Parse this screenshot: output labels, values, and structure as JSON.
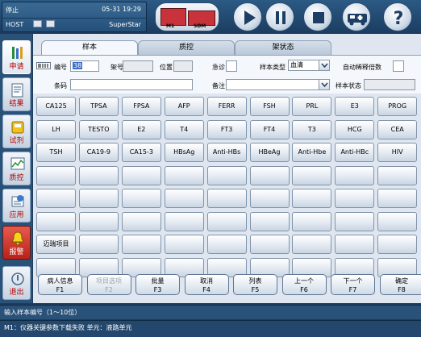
{
  "status": {
    "state": "停止",
    "time": "05-31 19:29",
    "host": "HOST",
    "system": "SuperStar"
  },
  "analyzer": {
    "module1": "M1",
    "module2": "SDM"
  },
  "toolbar_icons": [
    "play-icon",
    "pause-icon",
    "stop-icon",
    "ambulance-icon",
    "help-icon"
  ],
  "sidebar": {
    "items": [
      {
        "label": "申请",
        "icon": "tubes-icon"
      },
      {
        "label": "结果",
        "icon": "report-icon"
      },
      {
        "label": "试剂",
        "icon": "reagent-icon"
      },
      {
        "label": "质控",
        "icon": "chart-icon"
      },
      {
        "label": "应用",
        "icon": "app-icon"
      },
      {
        "label": "报警",
        "icon": "bell-icon"
      },
      {
        "label": "退出",
        "icon": "power-icon"
      }
    ]
  },
  "tabs": [
    "样本",
    "质控",
    "架状态"
  ],
  "form": {
    "sample_no_label": "编号",
    "sample_no_value": "38",
    "rack_label": "架号",
    "position_label": "位置",
    "stat_label": "急诊",
    "sample_type_label": "样本类型",
    "sample_type_value": "血清",
    "auto_dilution_label": "自动稀释倍数",
    "barcode_label": "条码",
    "note_label": "备注",
    "sample_status_label": "样本状态"
  },
  "tests": [
    [
      "CA125",
      "TPSA",
      "FPSA",
      "AFP",
      "FERR",
      "FSH",
      "PRL",
      "E3",
      "PROG"
    ],
    [
      "LH",
      "TESTO",
      "E2",
      "T4",
      "FT3",
      "FT4",
      "T3",
      "HCG",
      "CEA"
    ],
    [
      "TSH",
      "CA19-9",
      "CA15-3",
      "HBsAg",
      "Anti-HBs",
      "HBeAg",
      "Anti-Hbe",
      "Anti-HBc",
      "HIV"
    ],
    [
      "",
      "",
      "",
      "",
      "",
      "",
      "",
      "",
      ""
    ],
    [
      "",
      "",
      "",
      "",
      "",
      "",
      "",
      "",
      ""
    ],
    [
      "",
      "",
      "",
      "",
      "",
      "",
      "",
      "",
      ""
    ],
    [
      "迈瑞项目",
      "",
      "",
      "",
      "",
      "",
      "",
      "",
      ""
    ],
    [
      "",
      "",
      "",
      "",
      "",
      "",
      "",
      "",
      ""
    ]
  ],
  "fkeys": [
    {
      "label": "病人信息",
      "key": "F1",
      "enabled": true
    },
    {
      "label": "项目选项",
      "key": "F2",
      "enabled": false
    },
    {
      "label": "批量",
      "key": "F3",
      "enabled": true
    },
    {
      "label": "取消",
      "key": "F4",
      "enabled": true
    },
    {
      "label": "列表",
      "key": "F5",
      "enabled": true
    },
    {
      "label": "上一个",
      "key": "F6",
      "enabled": true
    },
    {
      "label": "下一个",
      "key": "F7",
      "enabled": true
    },
    {
      "label": "确定",
      "key": "F8",
      "enabled": true
    }
  ],
  "footer": {
    "hint": "输入样本编号（1～10位）",
    "message": "M1：仪器关键参数下载失败 单元：液路单元"
  }
}
